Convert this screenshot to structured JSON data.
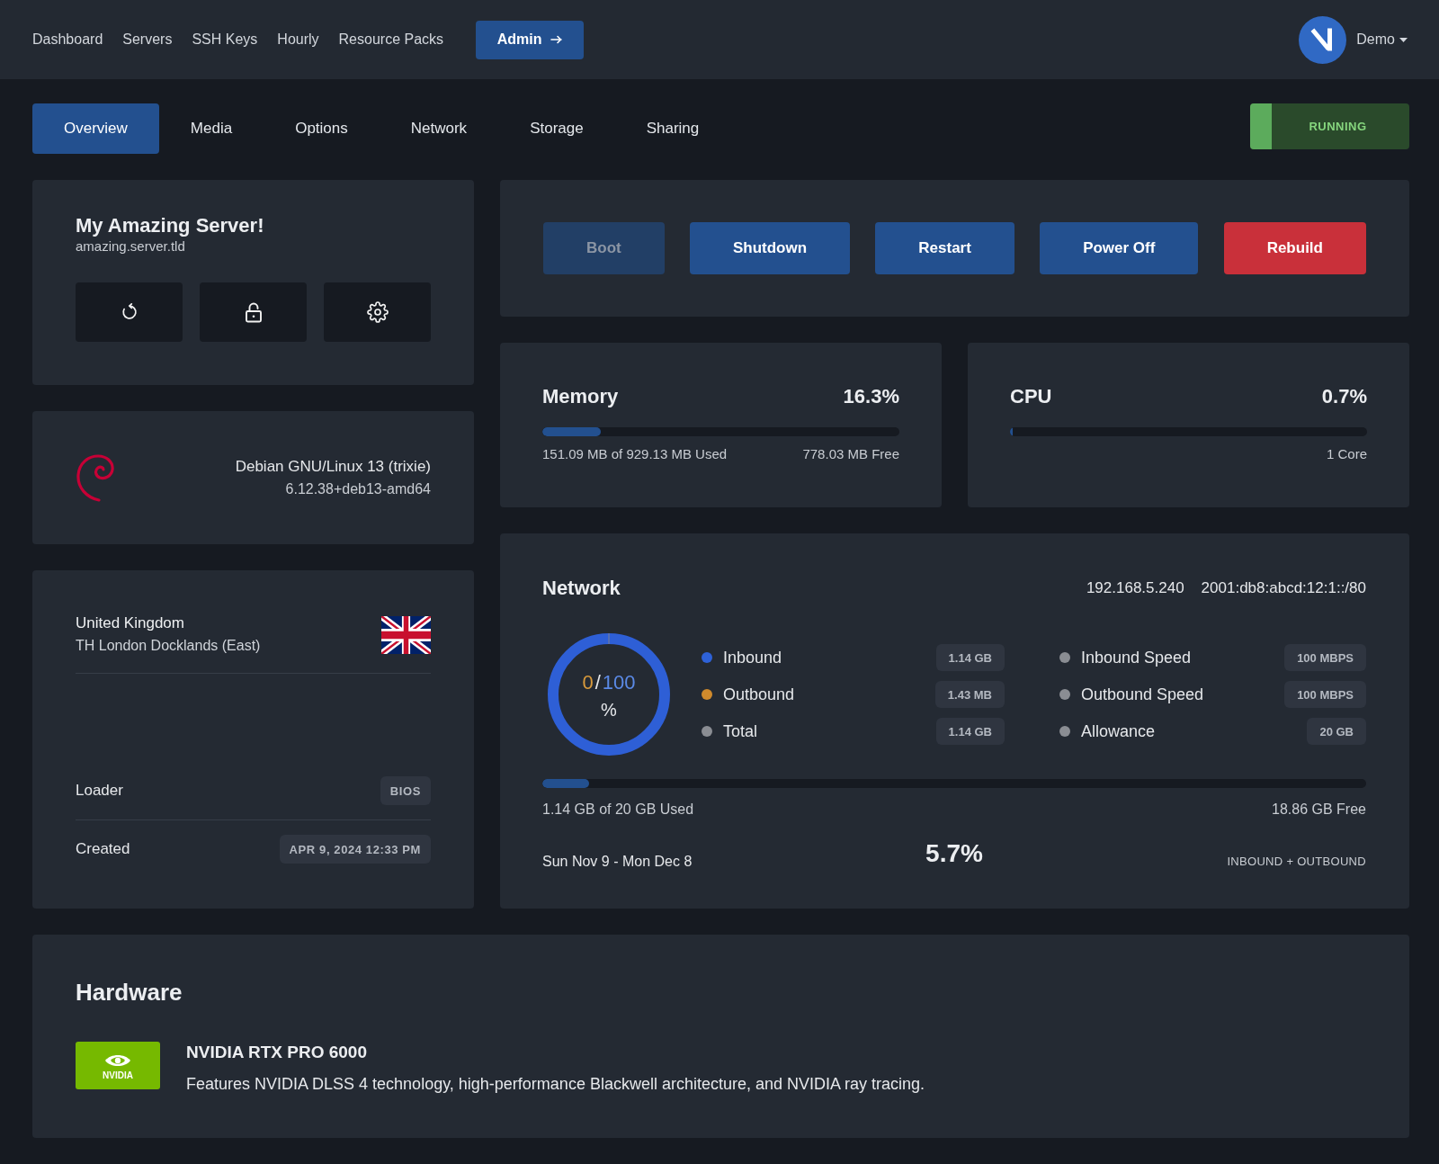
{
  "top_nav": {
    "links": [
      {
        "label": "Dashboard"
      },
      {
        "label": "Servers"
      },
      {
        "label": "SSH Keys"
      },
      {
        "label": "Hourly"
      },
      {
        "label": "Resource Packs"
      }
    ],
    "admin_button": {
      "label": "Admin"
    },
    "user_menu": {
      "label": "Demo"
    }
  },
  "tabs": [
    {
      "label": "Overview",
      "selected": true
    },
    {
      "label": "Media",
      "selected": false
    },
    {
      "label": "Options",
      "selected": false
    },
    {
      "label": "Network",
      "selected": false
    },
    {
      "label": "Storage",
      "selected": false
    },
    {
      "label": "Sharing",
      "selected": false
    }
  ],
  "status": {
    "label": "RUNNING",
    "kind": "running"
  },
  "server": {
    "name": "My Amazing Server!",
    "hostname": "amazing.server.tld"
  },
  "os": {
    "name": "Debian GNU/Linux 13 (trixie)",
    "kernel": "6.12.38+deb13-amd64"
  },
  "location": {
    "country": "United Kingdom",
    "datacenter": "TH London Docklands (East)",
    "details": [
      {
        "label": "Loader",
        "value": "BIOS"
      },
      {
        "label": "Created",
        "value": "APR 9, 2024 12:33 PM"
      }
    ]
  },
  "actions": [
    {
      "label": "Boot",
      "kind": "primary",
      "disabled": true
    },
    {
      "label": "Shutdown",
      "kind": "primary",
      "disabled": false
    },
    {
      "label": "Restart",
      "kind": "primary",
      "disabled": false
    },
    {
      "label": "Power Off",
      "kind": "primary",
      "disabled": false
    },
    {
      "label": "Rebuild",
      "kind": "danger",
      "disabled": false
    }
  ],
  "memory": {
    "title": "Memory",
    "percent": "16.3%",
    "level": 0.163,
    "used": "151.09 MB of 929.13 MB Used",
    "free": "778.03 MB Free"
  },
  "cpu": {
    "title": "CPU",
    "percent": "0.7%",
    "level": 0.007,
    "cores": "1 Core"
  },
  "network": {
    "title": "Network",
    "ipv4": "192.168.5.240",
    "ipv6": "2001:db8:abcd:12:1::/80",
    "gauge": {
      "used": "0",
      "separator": "/",
      "total": "100",
      "unit": "%"
    },
    "traffic": [
      {
        "label": "Inbound",
        "value": "1.14 GB",
        "color": "#2e62d9"
      },
      {
        "label": "Outbound",
        "value": "1.43 MB",
        "color": "#d08a2c"
      },
      {
        "label": "Total",
        "value": "1.14 GB",
        "color": "#8a8d93"
      }
    ],
    "limits": [
      {
        "label": "Inbound Speed",
        "value": "100 MBPS",
        "color": "#8a8d93"
      },
      {
        "label": "Outbound Speed",
        "value": "100 MBPS",
        "color": "#8a8d93"
      },
      {
        "label": "Allowance",
        "value": "20 GB",
        "color": "#8a8d93"
      }
    ],
    "usage": {
      "level": 0.057,
      "used": "1.14 GB of 20 GB Used",
      "free": "18.86 GB Free"
    },
    "period": "Sun Nov 9 - Mon Dec 8",
    "percent": "5.7%",
    "scope": "INBOUND + OUTBOUND"
  },
  "hardware": {
    "title": "Hardware",
    "items": [
      {
        "logo": "NVIDIA",
        "name": "NVIDIA RTX PRO 6000",
        "description": "Features NVIDIA DLSS 4 technology, high-performance Blackwell architecture, and NVIDIA ray tracing."
      }
    ]
  }
}
